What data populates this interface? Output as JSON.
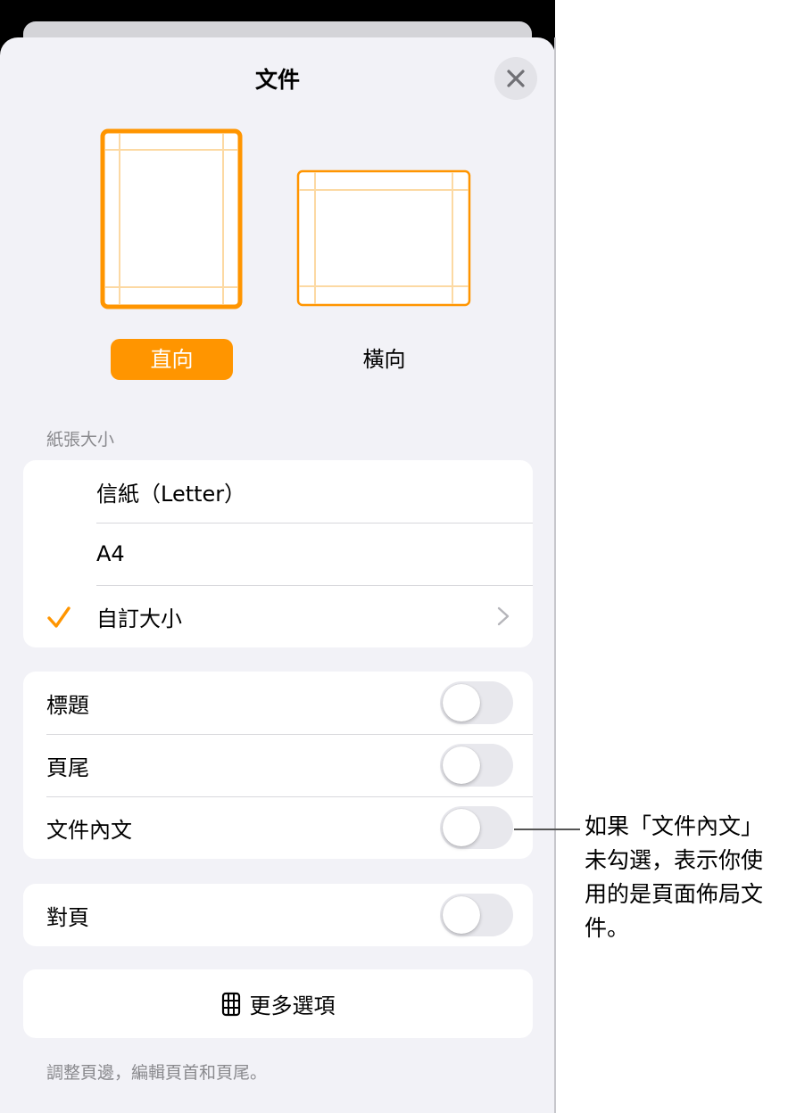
{
  "header": {
    "title": "文件"
  },
  "orientation": {
    "portrait_label": "直向",
    "landscape_label": "橫向",
    "selected": "portrait"
  },
  "paper_size": {
    "header": "紙張大小",
    "items": [
      {
        "label": "信紙（Letter）",
        "checked": false
      },
      {
        "label": "A4",
        "checked": false
      },
      {
        "label": "自訂大小",
        "checked": true
      }
    ]
  },
  "toggles": [
    {
      "label": "標題",
      "on": false
    },
    {
      "label": "頁尾",
      "on": false
    },
    {
      "label": "文件內文",
      "on": false
    }
  ],
  "facing": {
    "label": "對頁",
    "on": false
  },
  "more_options": {
    "label": "更多選項",
    "icon": "document-options-icon"
  },
  "footer_note": "調整頁邊，編輯頁首和頁尾。",
  "callout": "如果「文件內文」未勾選，表示你使用的是頁面佈局文件。",
  "colors": {
    "accent": "#ff9500",
    "panel_bg": "#f2f2f7",
    "toggle_off": "#e8e8ed"
  }
}
